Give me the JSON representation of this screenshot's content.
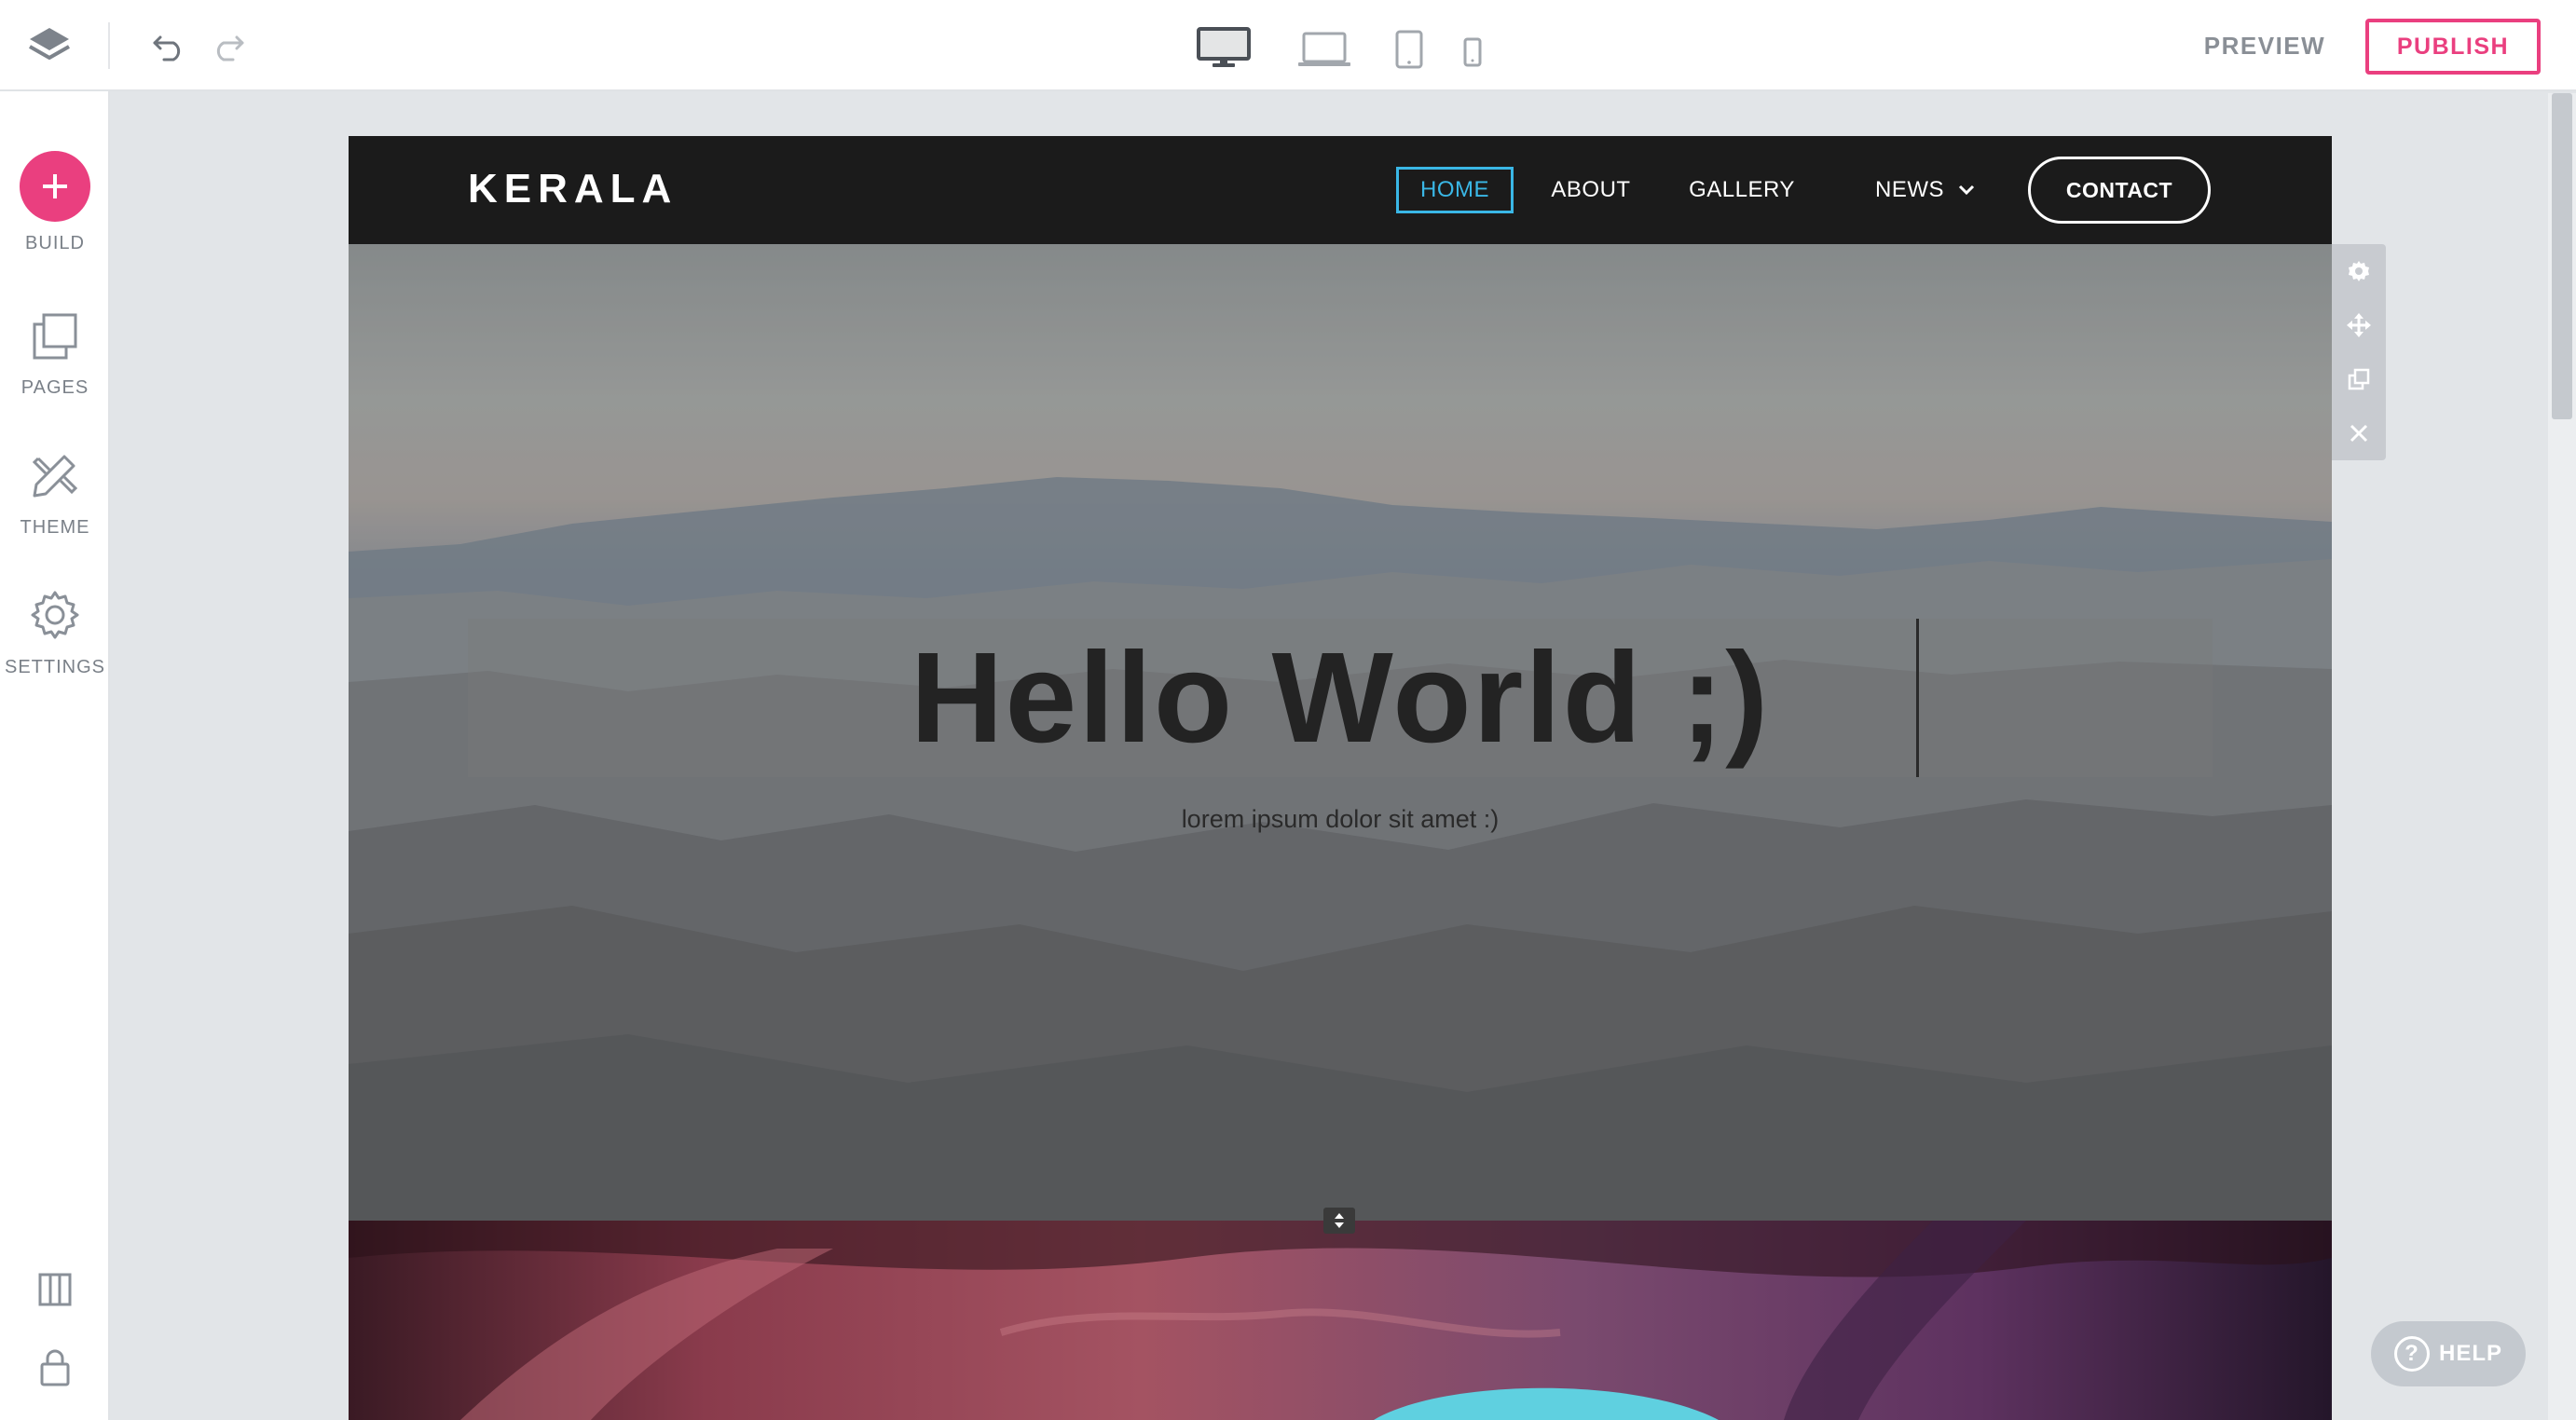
{
  "toolbar": {
    "layers_icon": "layers-icon",
    "undo_icon": "undo-icon",
    "redo_icon": "redo-icon",
    "devices": [
      "desktop",
      "laptop",
      "tablet",
      "mobile"
    ],
    "preview_label": "PREVIEW",
    "publish_label": "PUBLISH"
  },
  "sidebar": {
    "items": [
      {
        "label": "BUILD",
        "icon": "plus-icon"
      },
      {
        "label": "PAGES",
        "icon": "pages-icon"
      },
      {
        "label": "THEME",
        "icon": "theme-icon"
      },
      {
        "label": "SETTINGS",
        "icon": "gear-icon"
      }
    ],
    "bottom_icons": [
      "columns-icon",
      "lock-icon"
    ]
  },
  "site": {
    "logo": "KERALA",
    "nav": [
      {
        "label": "HOME",
        "active": true
      },
      {
        "label": "ABOUT"
      },
      {
        "label": "GALLERY"
      },
      {
        "label": "NEWS"
      }
    ],
    "contact_label": "CONTACT",
    "hero_heading": "Hello World ;)",
    "hero_subtext": "lorem ipsum dolor sit amet  :)"
  },
  "section_tools": [
    "gear-icon",
    "move-icon",
    "duplicate-icon",
    "close-icon"
  ],
  "help_label": "HELP",
  "colors": {
    "accent": "#ea3f7f",
    "nav_active": "#3ab7e6",
    "nav_bg": "#1b1b1b"
  }
}
